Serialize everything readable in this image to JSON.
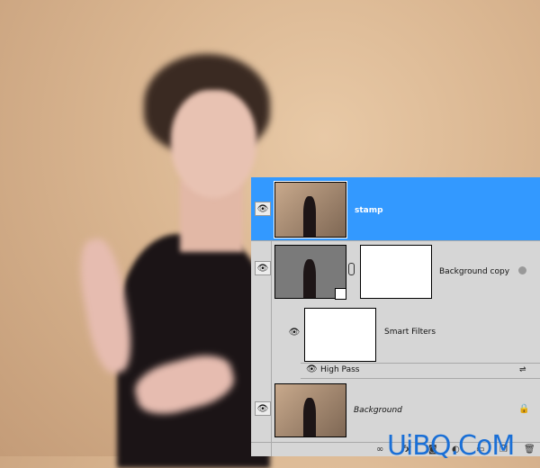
{
  "layers": [
    {
      "name": "stamp",
      "selected": true
    },
    {
      "name": "Background copy"
    },
    {
      "name": "Smart Filters"
    },
    {
      "name": "High Pass"
    },
    {
      "name": "Background",
      "locked": true
    }
  ],
  "toolbar": {
    "fx_label": "fx"
  },
  "watermark": "UiBQ.CoM",
  "colors": {
    "selected": "#3399ff",
    "panel": "#d6d6d6"
  }
}
